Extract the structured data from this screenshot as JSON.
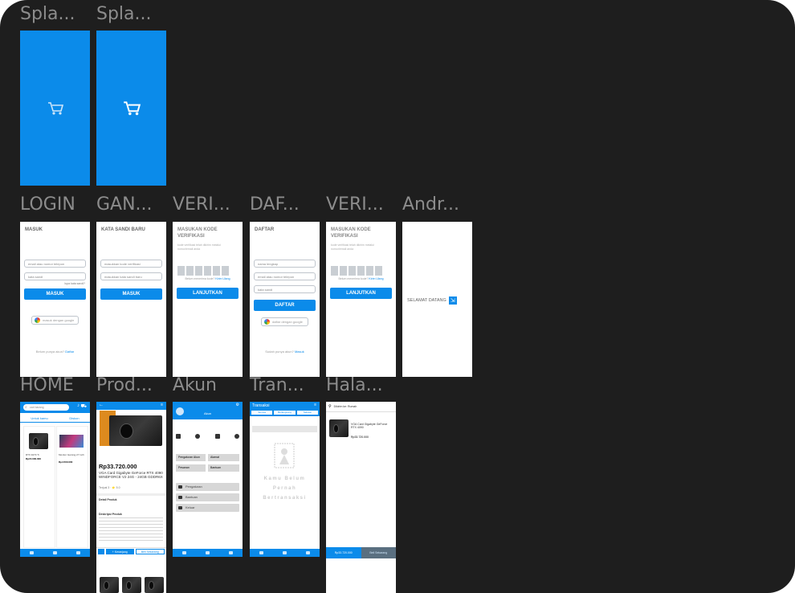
{
  "frames": {
    "splash1": {
      "label": "Spla..."
    },
    "splash2": {
      "label": "Spla..."
    },
    "login": {
      "label": "LOGIN",
      "title": "MASUK",
      "field1": "email atau nomor telepon",
      "field2": "kata sandi",
      "forgot": "lupa kata sandi?",
      "button": "MASUK",
      "google": "masuk dengan google",
      "bottom_text": "Belum punya akun?",
      "bottom_link": "Daftar"
    },
    "ganti": {
      "label": "GAN...",
      "title": "KATA SANDI BARU",
      "field1": "masukkan kode verifikasi",
      "field2": "masukkan kata sandi baru",
      "button": "MASUK"
    },
    "verif1": {
      "label": "VERI...",
      "title_line1": "MASUKAN KODE",
      "title_line2": "VERIFIKASI",
      "desc": "kode verifikasi telah dikirim melalui nomor/email anda",
      "resend": "Belum menerima kode?",
      "resend_link": "Kirim Ulang",
      "button": "LANJUTKAN"
    },
    "daftar": {
      "label": "DAF...",
      "title": "DAFTAR",
      "field1": "nama lengkap",
      "field2": "email atau nomor telepon",
      "field3": "kata sandi",
      "button": "DAFTAR",
      "google": "daftar dengan google",
      "bottom_text": "Sudah punya akun?",
      "bottom_link": "Masuk"
    },
    "verif2": {
      "label": "VERI...",
      "title_line1": "MASUKAN KODE",
      "title_line2": "VERIFIKASI",
      "desc": "kode verifikasi telah dikirim melalui nomor/email anda",
      "resend": "Belum menerima kode?",
      "resend_link": "Kirim Ulang",
      "button": "LANJUTKAN"
    },
    "android": {
      "label": "Andr...",
      "welcome": "SELAMAT DATANG"
    },
    "home": {
      "label": "HOME",
      "search": "cari barang",
      "tab1": "Untuk kamu",
      "tab2": "Diskon",
      "p1_name": "RTX 4070 Ti",
      "p1_price": "Rp15.000.000",
      "p2_name": "Monitor Gaming 27 inch",
      "p2_price": "Rp4.500.000"
    },
    "product": {
      "label": "Prod...",
      "price": "Rp33.720.000",
      "name": "VGA Card Gigabyte GeForce RTX 4090 WINDFORCE V2 24G - 24GB GDDR6X",
      "rating": "Terjual 3 · ⭐ 5.0",
      "section_detail": "Detail Produk",
      "section_desc": "Deskripsi Produk",
      "btn_cart": "+ Keranjang",
      "btn_buy": "Beli Sekarang"
    },
    "akun": {
      "label": "Akun",
      "user": "Akun",
      "menu1": "Pengaturan Akun",
      "menu2": "Alamat",
      "menu3": "Pesanan",
      "menu4": "Bantuan",
      "menu5": "Pengaturan",
      "menu6": "Keluar"
    },
    "transaksi": {
      "label": "Tran...",
      "header": "Transaksi",
      "chip1": "Semua",
      "chip2": "Berlangsung",
      "chip3": "Selesai",
      "empty_line1": "Kamu Belum",
      "empty_line2": "Pernah",
      "empty_line3": "Bertransaksi"
    },
    "halaman": {
      "label": "Hala...",
      "address": "Dikirim ke: Rumah",
      "item_name": "VGA Card Gigabyte GeForce RTX 4090",
      "item_price": "Rp33.720.000",
      "total": "Rp33.720.000",
      "checkout": "Beli Sekarang"
    }
  }
}
